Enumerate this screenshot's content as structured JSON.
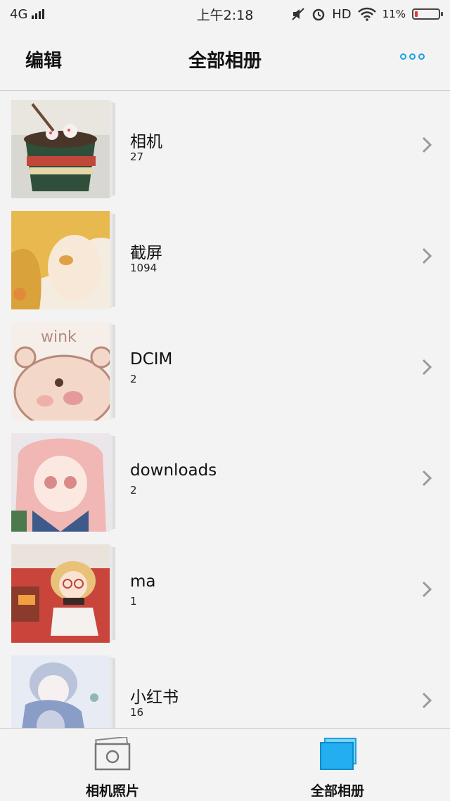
{
  "status_bar": {
    "network": "4G",
    "time": "上午2:18",
    "hd": "HD",
    "battery_percent": "11%",
    "battery_level": 0.11
  },
  "header": {
    "edit_label": "编辑",
    "title": "全部相册",
    "more_icon": "more-dots-icon",
    "accent_color": "#1ba1e2"
  },
  "albums": [
    {
      "name": "相机",
      "count": "27"
    },
    {
      "name": "截屏",
      "count": "1094"
    },
    {
      "name": "DCIM",
      "count": "2"
    },
    {
      "name": "downloads",
      "count": "2"
    },
    {
      "name": "ma",
      "count": "1"
    },
    {
      "name": "小红书",
      "count": "16"
    }
  ],
  "tabs": [
    {
      "label": "相机照片",
      "icon": "camera-photos-icon",
      "active": false
    },
    {
      "label": "全部相册",
      "icon": "all-albums-icon",
      "active": true
    }
  ]
}
